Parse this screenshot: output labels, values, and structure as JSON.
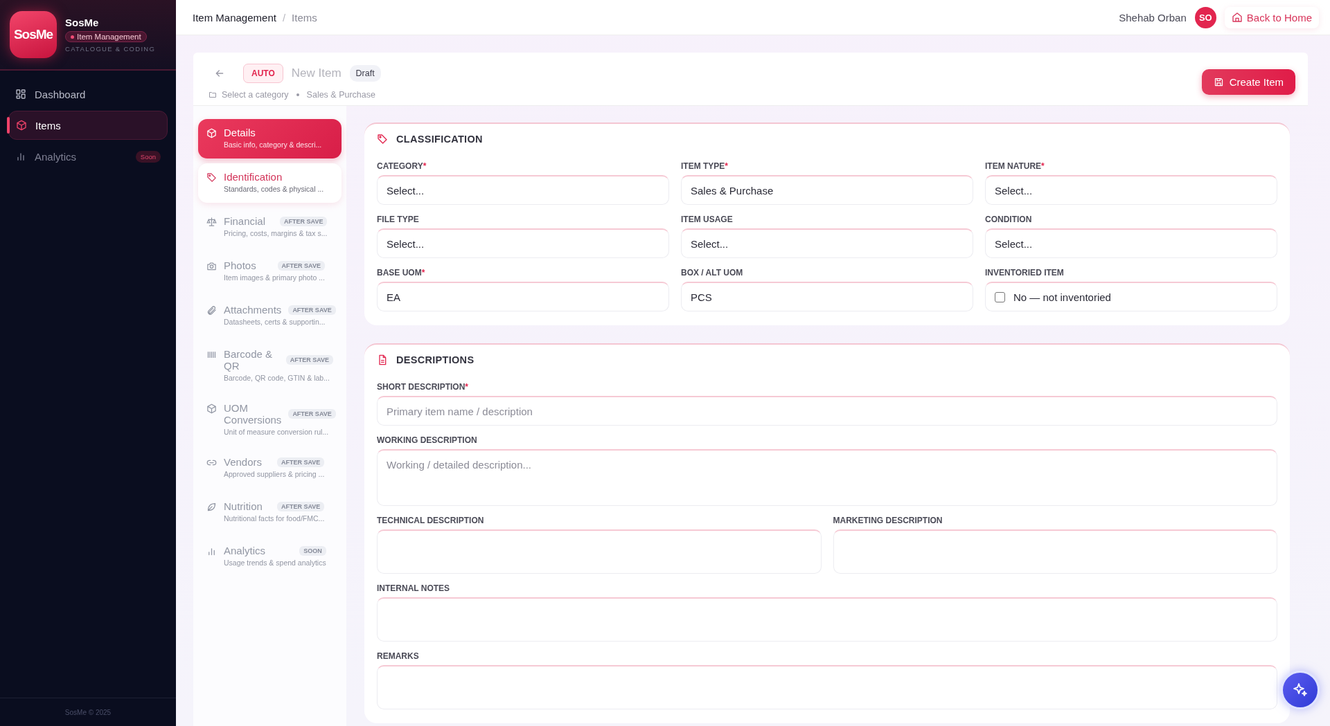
{
  "sidebar": {
    "logo": "SosMe",
    "brand": "SosMe",
    "module": "Item Management",
    "subtitle": "CATALOGUE & CODING",
    "items": [
      {
        "label": "Dashboard",
        "selected": false
      },
      {
        "label": "Items",
        "selected": true
      },
      {
        "label": "Analytics",
        "selected": false,
        "badge": "Soon"
      }
    ],
    "footer": "SosMe © 2025"
  },
  "topbar": {
    "breadcrumb": [
      "Item Management",
      "Items"
    ],
    "separator": "/",
    "user": "Shehab Orban",
    "avatar": "SO",
    "home_button": "Back to Home"
  },
  "header": {
    "code": "AUTO",
    "title": "New Item",
    "status": "Draft",
    "category": "Select a category",
    "type": "Sales & Purchase",
    "create_button": "Create Item"
  },
  "steps": [
    {
      "title": "Details",
      "subtitle": "Basic info, category & descri...",
      "selected": true,
      "disabled": false
    },
    {
      "title": "Identification",
      "subtitle": "Standards, codes & physical ...",
      "selected": false,
      "disabled": false
    },
    {
      "title": "Financial",
      "subtitle": "Pricing, costs, margins & tax s...",
      "selected": false,
      "disabled": true,
      "badge": "AFTER SAVE"
    },
    {
      "title": "Photos",
      "subtitle": "Item images & primary photo ...",
      "selected": false,
      "disabled": true,
      "badge": "AFTER SAVE"
    },
    {
      "title": "Attachments",
      "subtitle": "Datasheets, certs & supportin...",
      "selected": false,
      "disabled": true,
      "badge": "AFTER SAVE"
    },
    {
      "title": "Barcode & QR",
      "subtitle": "Barcode, QR code, GTIN & lab...",
      "selected": false,
      "disabled": true,
      "badge": "AFTER SAVE"
    },
    {
      "title": "UOM Conversions",
      "subtitle": "Unit of measure conversion rul...",
      "selected": false,
      "disabled": true,
      "badge": "AFTER SAVE"
    },
    {
      "title": "Vendors",
      "subtitle": "Approved suppliers & pricing ...",
      "selected": false,
      "disabled": true,
      "badge": "AFTER SAVE"
    },
    {
      "title": "Nutrition",
      "subtitle": "Nutritional facts for food/FMC...",
      "selected": false,
      "disabled": true,
      "badge": "AFTER SAVE"
    },
    {
      "title": "Analytics",
      "subtitle": "Usage trends & spend analytics",
      "selected": false,
      "disabled": true,
      "badge": "SOON"
    }
  ],
  "sections": [
    {
      "title": "CLASSIFICATION",
      "rows": [
        [
          {
            "label": "CATEGORY",
            "mark": "*",
            "kind": "select",
            "value": "Select..."
          },
          {
            "label": "ITEM TYPE",
            "mark": "*",
            "kind": "select",
            "value": "Sales & Purchase"
          },
          {
            "label": "ITEM NATURE",
            "mark": "*",
            "kind": "select",
            "value": "Select..."
          }
        ],
        [
          {
            "label": "FILE TYPE",
            "kind": "select",
            "value": "Select..."
          },
          {
            "label": "ITEM USAGE",
            "kind": "select",
            "value": "Select..."
          },
          {
            "label": "CONDITION",
            "kind": "select",
            "value": "Select..."
          }
        ],
        [
          {
            "label": "BASE UOM",
            "mark": "*",
            "kind": "text",
            "value": "EA"
          },
          {
            "label": "BOX / ALT UOM",
            "kind": "text",
            "value": "PCS"
          },
          {
            "label": "INVENTORIED ITEM",
            "kind": "checkbox",
            "text": "No — not inventoried",
            "checked": false
          }
        ]
      ]
    },
    {
      "title": "DESCRIPTIONS",
      "rows": [
        [
          {
            "label": "SHORT DESCRIPTION",
            "mark": "*",
            "kind": "text",
            "placeholder": "Primary item name / description"
          }
        ],
        [
          {
            "label": "WORKING DESCRIPTION",
            "kind": "textarea",
            "placeholder": "Working / detailed description..."
          }
        ],
        [
          {
            "label": "TECHNICAL DESCRIPTION",
            "kind": "textarea"
          },
          {
            "label": "MARKETING DESCRIPTION",
            "kind": "textarea"
          }
        ],
        [
          {
            "label": "INTERNAL NOTES",
            "kind": "textarea"
          }
        ],
        [
          {
            "label": "REMARKS",
            "kind": "textarea"
          }
        ]
      ]
    }
  ]
}
